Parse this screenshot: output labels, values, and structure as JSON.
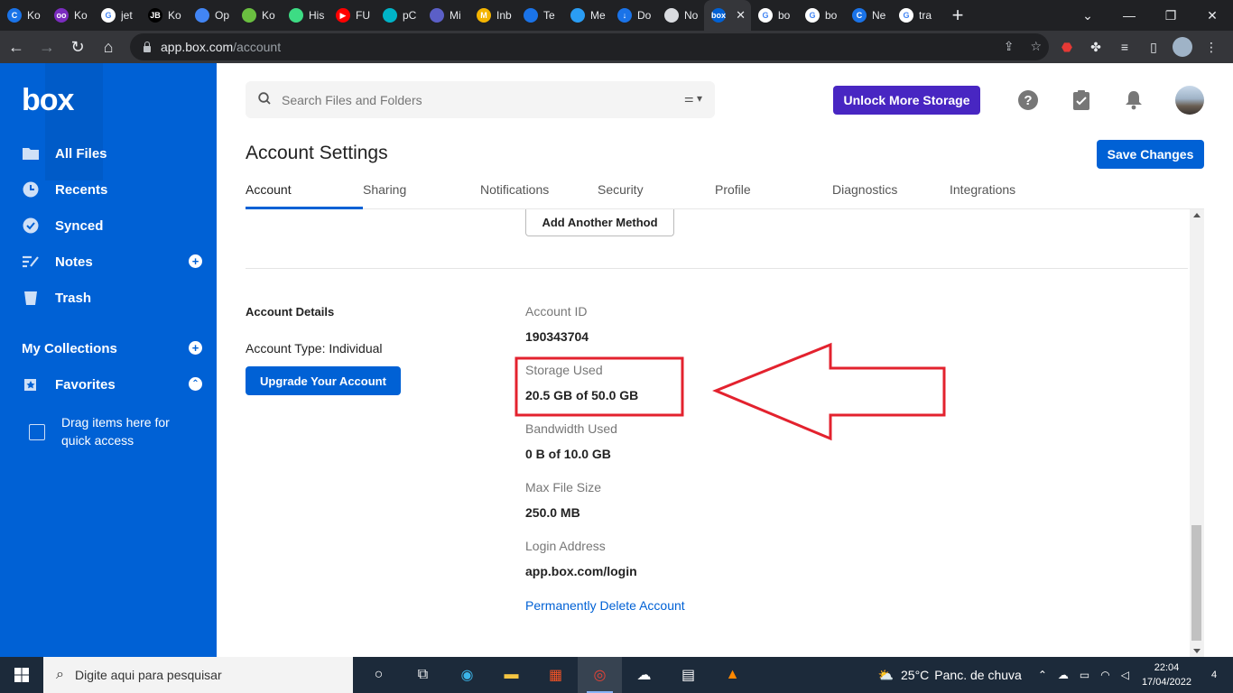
{
  "browser": {
    "tabs": [
      {
        "title": "Ko",
        "color": "#1a73e8",
        "glyph": "C"
      },
      {
        "title": "Ko",
        "color": "#7b2cbf",
        "glyph": "oo"
      },
      {
        "title": "jet",
        "color": "#ffffff",
        "glyph": "G"
      },
      {
        "title": "Ko",
        "color": "#000000",
        "glyph": "JB"
      },
      {
        "title": "Op",
        "color": "#4285f4",
        "glyph": ""
      },
      {
        "title": "Ko",
        "color": "#6abf40",
        "glyph": ""
      },
      {
        "title": "His",
        "color": "#3ddc84",
        "glyph": ""
      },
      {
        "title": "FU",
        "color": "#ff0000",
        "glyph": "▶"
      },
      {
        "title": "pC",
        "color": "#00b4c8",
        "glyph": ""
      },
      {
        "title": "Mi",
        "color": "#5b5fc7",
        "glyph": ""
      },
      {
        "title": "Inb",
        "color": "#f4b400",
        "glyph": "M"
      },
      {
        "title": "Te",
        "color": "#1a73e8",
        "glyph": ""
      },
      {
        "title": "Me",
        "color": "#2a9df4",
        "glyph": ""
      },
      {
        "title": "Do",
        "color": "#1a73e8",
        "glyph": "↓"
      },
      {
        "title": "No",
        "color": "#dadce0",
        "glyph": ""
      },
      {
        "title": "box",
        "color": "#0061d5",
        "glyph": "box",
        "active": true
      },
      {
        "title": "bo",
        "color": "#ffffff",
        "glyph": "G"
      },
      {
        "title": "bo",
        "color": "#ffffff",
        "glyph": "G"
      },
      {
        "title": "Ne",
        "color": "#1a73e8",
        "glyph": "C"
      },
      {
        "title": "tra",
        "color": "#ffffff",
        "glyph": "G"
      }
    ],
    "url_host": "app.box.com",
    "url_path": "/account"
  },
  "sidebar": {
    "logo": "box",
    "items": [
      {
        "label": "All Files",
        "icon": "folder-icon"
      },
      {
        "label": "Recents",
        "icon": "clock-icon"
      },
      {
        "label": "Synced",
        "icon": "check-circle-icon"
      },
      {
        "label": "Notes",
        "icon": "notes-icon"
      },
      {
        "label": "Trash",
        "icon": "trash-icon"
      }
    ],
    "collections_label": "My Collections",
    "favorites_label": "Favorites",
    "drag_hint": "Drag items here for quick access"
  },
  "header": {
    "search_placeholder": "Search Files and Folders",
    "unlock_label": "Unlock More Storage",
    "help_glyph": "?"
  },
  "page": {
    "title": "Account Settings",
    "save_label": "Save Changes",
    "tabs": [
      "Account",
      "Sharing",
      "Notifications",
      "Security",
      "Profile",
      "Diagnostics",
      "Integrations"
    ],
    "add_method_label": "Add Another Method",
    "account_details_title": "Account Details",
    "account_type": "Account Type: Individual",
    "upgrade_label": "Upgrade Your Account",
    "fields": [
      {
        "label": "Account ID",
        "value": "190343704"
      },
      {
        "label": "Storage Used",
        "value": "20.5 GB of 50.0 GB"
      },
      {
        "label": "Bandwidth Used",
        "value": "0 B of 10.0 GB"
      },
      {
        "label": "Max File Size",
        "value": "250.0 MB"
      },
      {
        "label": "Login Address",
        "value": "app.box.com/login"
      }
    ],
    "delete_label": "Permanently Delete Account"
  },
  "annotation": {
    "color": "#e3222e"
  },
  "taskbar": {
    "search_placeholder": "Digite aqui para pesquisar",
    "temperature": "25°C",
    "weather": "Panc. de chuva",
    "time": "22:04",
    "date": "17/04/2022",
    "notifications": "4"
  }
}
